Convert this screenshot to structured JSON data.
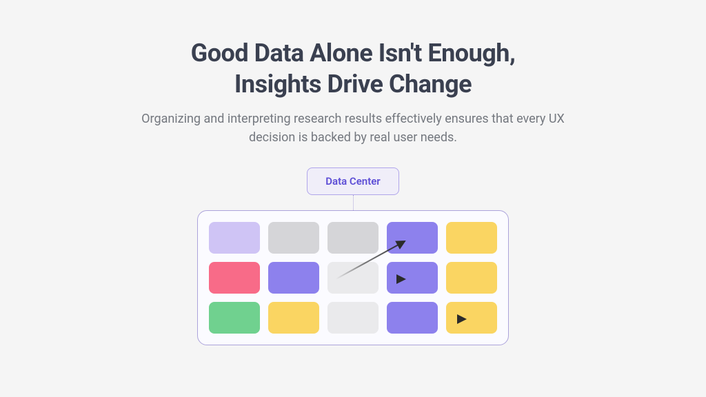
{
  "title_line1": "Good Data Alone Isn't Enough,",
  "title_line2": "Insights Drive Change",
  "subtitle": "Organizing and interpreting research results effectively ensures that every UX decision is backed by real user needs.",
  "diagram": {
    "label": "Data Center",
    "grid": [
      [
        "lavender",
        "gray",
        "gray",
        "purple",
        "yellow"
      ],
      [
        "pink",
        "purple",
        "lightgray",
        "purple",
        "yellow"
      ],
      [
        "green",
        "yellow",
        "lightgray",
        "purple",
        "yellow"
      ]
    ],
    "colors": {
      "lavender": "#cfc4f5",
      "gray": "#d5d5d8",
      "purple": "#8d81ed",
      "yellow": "#fad562",
      "pink": "#f86b88",
      "lightgray": "#eaeaec",
      "green": "#70d18f"
    },
    "arrows": [
      {
        "from_row": 1,
        "from_col": 2,
        "to_row": 0,
        "to_col": 3
      },
      {
        "from_row": 1,
        "from_col": 2,
        "to_row": 1,
        "to_col": 3
      },
      {
        "from_row": 2,
        "from_col": 2,
        "to_row": 2,
        "to_col": 4
      }
    ]
  }
}
